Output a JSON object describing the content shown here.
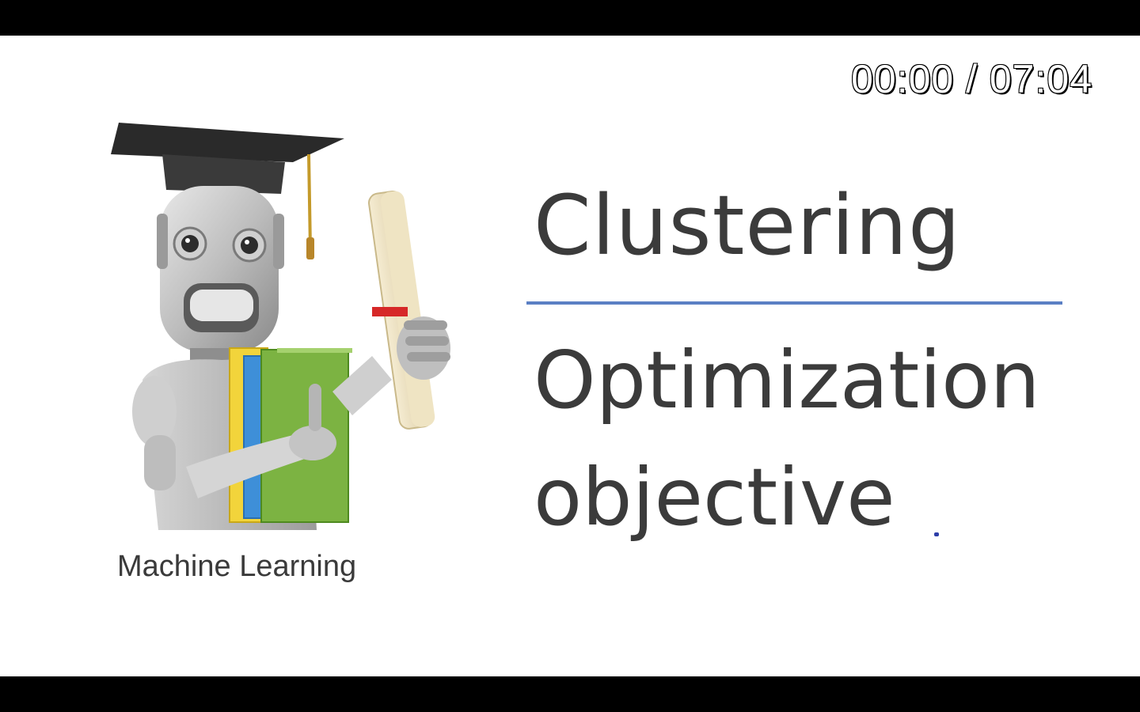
{
  "player": {
    "timecode": "00:00 / 07:04"
  },
  "slide": {
    "title": "Clustering",
    "subtitle_line1": "Optimization",
    "subtitle_line2": "objective",
    "course_label": "Machine Learning",
    "rule_color": "#5b7fc4",
    "mascot": "graduate-robot-illustration"
  }
}
